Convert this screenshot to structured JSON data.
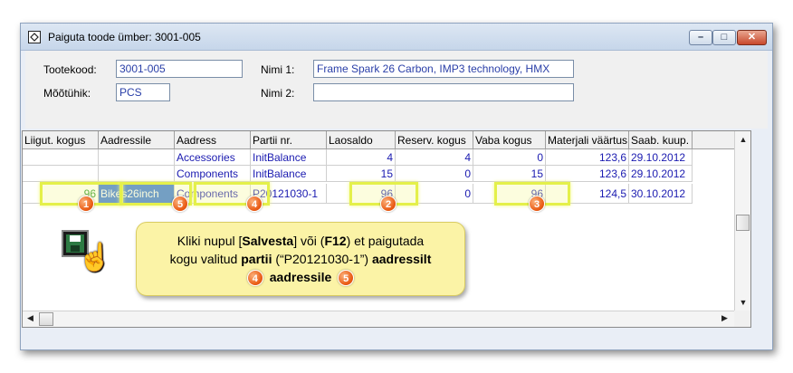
{
  "window": {
    "title": "Paiguta toode ümber: 3001-005",
    "minimize_glyph": "–",
    "maximize_glyph": "□",
    "close_glyph": "✕"
  },
  "form": {
    "tootekood_label": "Tootekood:",
    "tootekood_value": "3001-005",
    "mootuhik_label": "Mõõtühik:",
    "mootuhik_value": "PCS",
    "nimi1_label": "Nimi 1:",
    "nimi1_value": "Frame Spark 26 Carbon, IMP3 technology, HMX",
    "nimi2_label": "Nimi 2:",
    "nimi2_value": ""
  },
  "grid": {
    "columns": [
      "Liigut. kogus",
      "Aadressile",
      "Aadress",
      "Partii nr.",
      "Laosaldo",
      "Reserv. kogus",
      "Vaba kogus",
      "Materjali väärtus",
      "Saab. kuup."
    ],
    "rows": [
      [
        "",
        "",
        "Accessories",
        "InitBalance",
        "4",
        "4",
        "0",
        "123,6",
        "29.10.2012"
      ],
      [
        "",
        "",
        "Components",
        "InitBalance",
        "15",
        "0",
        "15",
        "123,6",
        "29.10.2012"
      ],
      [
        "96",
        "Bikes26inch",
        "Components",
        "P20121030-1",
        "96",
        "0",
        "96",
        "124,5",
        "30.10.2012"
      ]
    ]
  },
  "badges": [
    "1",
    "5",
    "4",
    "2",
    "3"
  ],
  "callout": {
    "line1_a": "Kliki nupul [",
    "line1_b": "Salvesta",
    "line1_c": "] või (",
    "line1_d": "F12",
    "line1_e": ") et paigutada",
    "line2_a": "kogu valitud ",
    "line2_b": "partii",
    "line2_c": " (“P20121030-1”) ",
    "line2_d": "aadressilt",
    "line3_badge1": "4",
    "line3_b": "aadressile",
    "line3_badge2": "5"
  },
  "icons": [
    "app-icon",
    "save-icon",
    "pointer-hand-icon"
  ],
  "colors": {
    "highlight": "#e4f04a",
    "badge": "#ea5c15",
    "callout": "#fbf3a6",
    "selection": "#2f6fd6"
  }
}
